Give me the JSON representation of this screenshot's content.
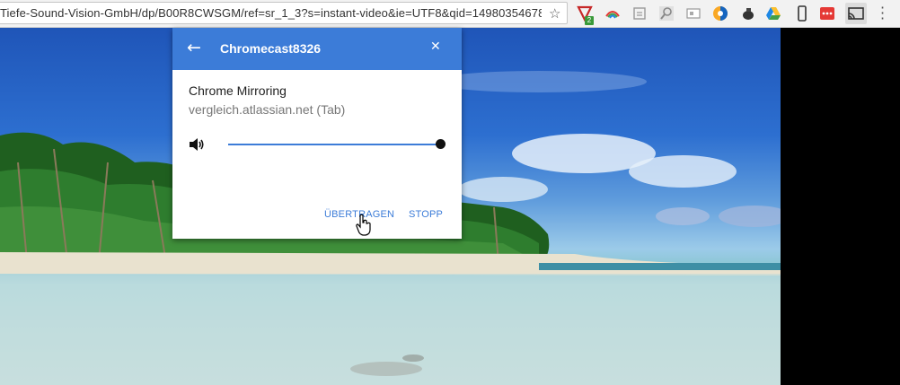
{
  "browser": {
    "url": "Tiefe-Sound-Vision-GmbH/dp/B00R8CWSGM/ref=sr_1_3?s=instant-video&ie=UTF8&qid=14980354678",
    "extension_badge": "2",
    "extensions": [
      "ublock-icon",
      "rainbow-icon",
      "box-icon",
      "magnifier-icon",
      "window-icon",
      "color-ball-icon",
      "mouse-icon",
      "drive-icon",
      "phone-icon",
      "red-dots-icon",
      "cast-icon",
      "kebab-menu-icon"
    ]
  },
  "cast_dialog": {
    "device_name": "Chromecast8326",
    "activity_title": "Chrome Mirroring",
    "activity_subtitle": "vergleich.atlassian.net (Tab)",
    "volume_level": 1.0,
    "cast_button_label": "ÜBERTRAGEN",
    "stop_button_label": "STOPP",
    "accent_color": "#3c7cd8"
  }
}
